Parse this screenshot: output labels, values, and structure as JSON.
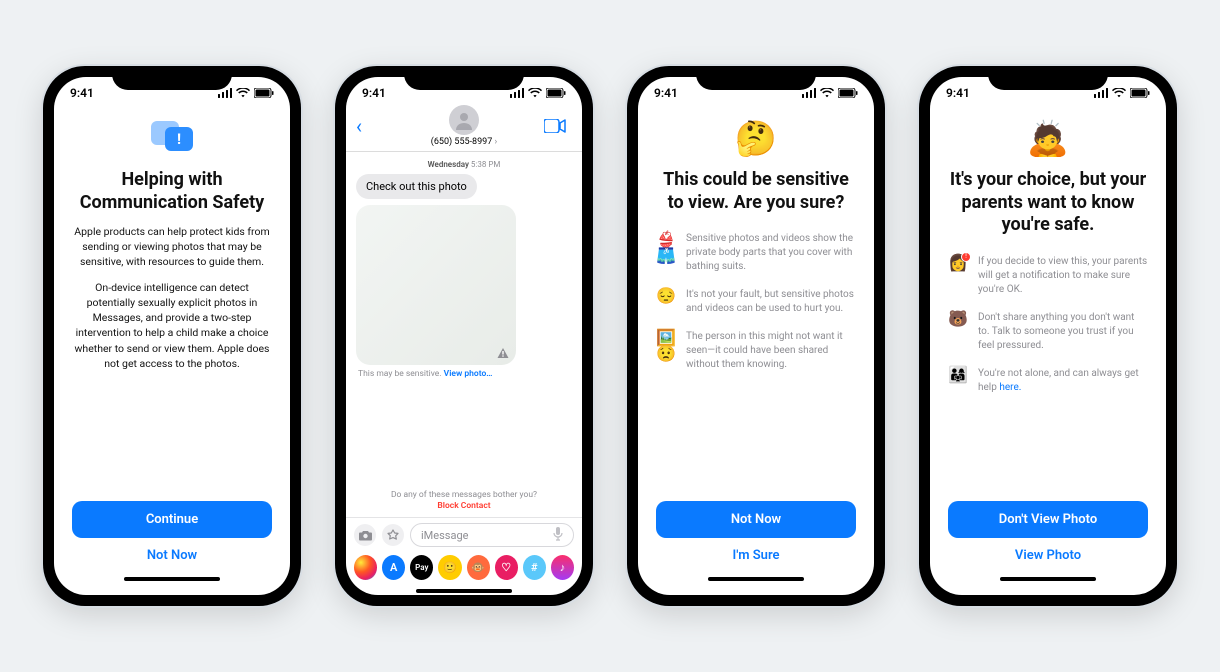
{
  "status": {
    "time": "9:41"
  },
  "phone1": {
    "title": "Helping with Communication Safety",
    "para1": "Apple products can help protect kids from sending or viewing photos that may be sensitive, with resources to guide them.",
    "para2": "On-device intelligence can detect potentially sexually explicit photos in Messages, and provide a two-step intervention to help a child make a choice whether to send or view them. Apple does not get access to the photos.",
    "primary": "Continue",
    "secondary": "Not Now"
  },
  "phone2": {
    "contact_number": "(650) 555-8997",
    "day": "Wednesday",
    "msg_time": "5:38 PM",
    "bubble": "Check out this photo",
    "caption_prefix": "This may be sensitive. ",
    "caption_link": "View photo…",
    "bother": "Do any of these messages bother you?",
    "block": "Block Contact",
    "placeholder": "iMessage"
  },
  "phone3": {
    "emoji": "🤔",
    "title": "This could be sensitive to view. Are you sure?",
    "bullets": [
      {
        "icon": "👙🩳",
        "text": "Sensitive photos and videos show the private body parts that you cover with bathing suits."
      },
      {
        "icon": "😔",
        "text": "It's not your fault, but sensitive photos and videos can be used to hurt you."
      },
      {
        "icon": "🖼️😟",
        "text": "The person in this might not want it seen—it could have been shared without them knowing."
      }
    ],
    "primary": "Not Now",
    "secondary": "I'm Sure"
  },
  "phone4": {
    "emoji": "🙇",
    "title": "It's your choice, but your parents want to know you're safe.",
    "bullets": [
      {
        "icon": "👩",
        "badge": "!",
        "text": "If you decide to view this, your parents will get a notification to make sure you're OK."
      },
      {
        "icon": "🐻",
        "text": "Don't share anything you don't want to. Talk to someone you trust if you feel pressured."
      },
      {
        "icon": "👨‍👩‍👧",
        "text": "You're not alone, and can always get help ",
        "link": "here."
      }
    ],
    "primary": "Don't View Photo",
    "secondary": "View Photo"
  }
}
